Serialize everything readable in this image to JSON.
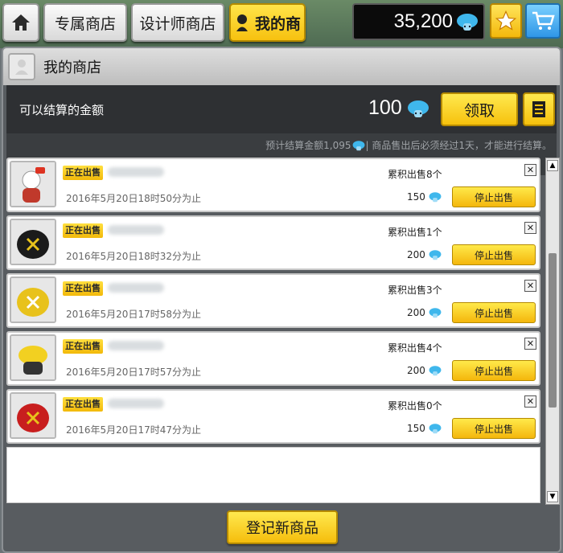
{
  "tabs": {
    "home": "home-icon",
    "exclusive_shop": "专属商店",
    "designer_shop": "设计师商店",
    "my_shop": "我的商"
  },
  "currency": {
    "amount": "35,200",
    "icon": "mushroom-coin-icon"
  },
  "panel": {
    "title": "我的商店"
  },
  "settlement": {
    "label": "可以结算的金额",
    "amount": "100",
    "claim_label": "领取",
    "note_prefix": "预计结算金额1,095",
    "note_suffix": "| 商品售出后必须经过1天，才能进行结算。"
  },
  "items": [
    {
      "status": "正在出售",
      "date": "2016年5月20日18时50分为止",
      "sold": "累积出售8个",
      "price": "150",
      "stop_label": "停止出售",
      "thumb_color": "#c0392b"
    },
    {
      "status": "正在出售",
      "date": "2016年5月20日18时32分为止",
      "sold": "累积出售1个",
      "price": "200",
      "stop_label": "停止出售",
      "thumb_color": "#1b1b1b"
    },
    {
      "status": "正在出售",
      "date": "2016年5月20日17时58分为止",
      "sold": "累积出售3个",
      "price": "200",
      "stop_label": "停止出售",
      "thumb_color": "#e8c21c"
    },
    {
      "status": "正在出售",
      "date": "2016年5月20日17时57分为止",
      "sold": "累积出售4个",
      "price": "200",
      "stop_label": "停止出售",
      "thumb_color": "#f2d021"
    },
    {
      "status": "正在出售",
      "date": "2016年5月20日17时47分为止",
      "sold": "累积出售0个",
      "price": "150",
      "stop_label": "停止出售",
      "thumb_color": "#c81e1e"
    }
  ],
  "register_label": "登记新商品",
  "colors": {
    "accent_yellow": "#f6c10d",
    "mushroom_blue": "#3fb7ec"
  }
}
